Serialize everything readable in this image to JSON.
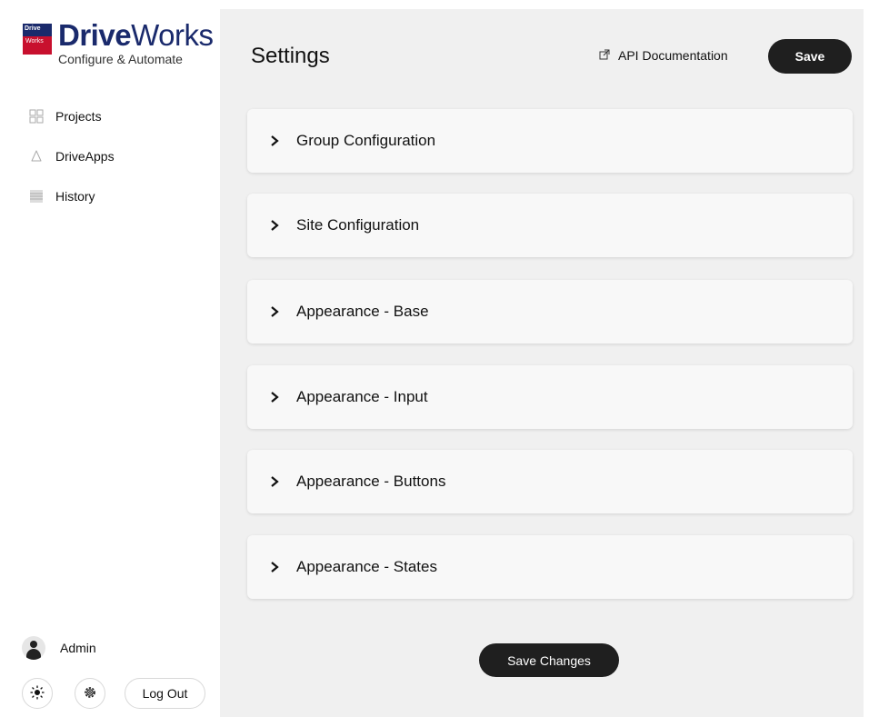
{
  "brand": {
    "badge_top": "Drive",
    "badge_bottom": "Works",
    "name_bold": "Drive",
    "name_regular": "Works",
    "tagline": "Configure & Automate"
  },
  "sidebar": {
    "items": [
      {
        "label": "Projects",
        "icon": "grid-icon"
      },
      {
        "label": "DriveApps",
        "icon": "bell-icon"
      },
      {
        "label": "History",
        "icon": "list-icon"
      }
    ],
    "user": {
      "name": "Admin",
      "icon": "avatar-icon"
    },
    "footer": {
      "theme_icon": "sun-icon",
      "settings_icon": "gear-icon",
      "logout_label": "Log Out"
    }
  },
  "header": {
    "title": "Settings",
    "api_link_label": "API Documentation",
    "save_label": "Save"
  },
  "sections": [
    {
      "label": "Group Configuration"
    },
    {
      "label": "Site Configuration"
    },
    {
      "label": "Appearance - Base"
    },
    {
      "label": "Appearance - Input"
    },
    {
      "label": "Appearance - Buttons"
    },
    {
      "label": "Appearance - States"
    }
  ],
  "footer": {
    "save_changes_label": "Save Changes"
  },
  "colors": {
    "brand_blue": "#1a2a6c",
    "brand_red": "#c8102e",
    "button_dark": "#1f1f1f",
    "main_bg": "#f0f0f0"
  }
}
